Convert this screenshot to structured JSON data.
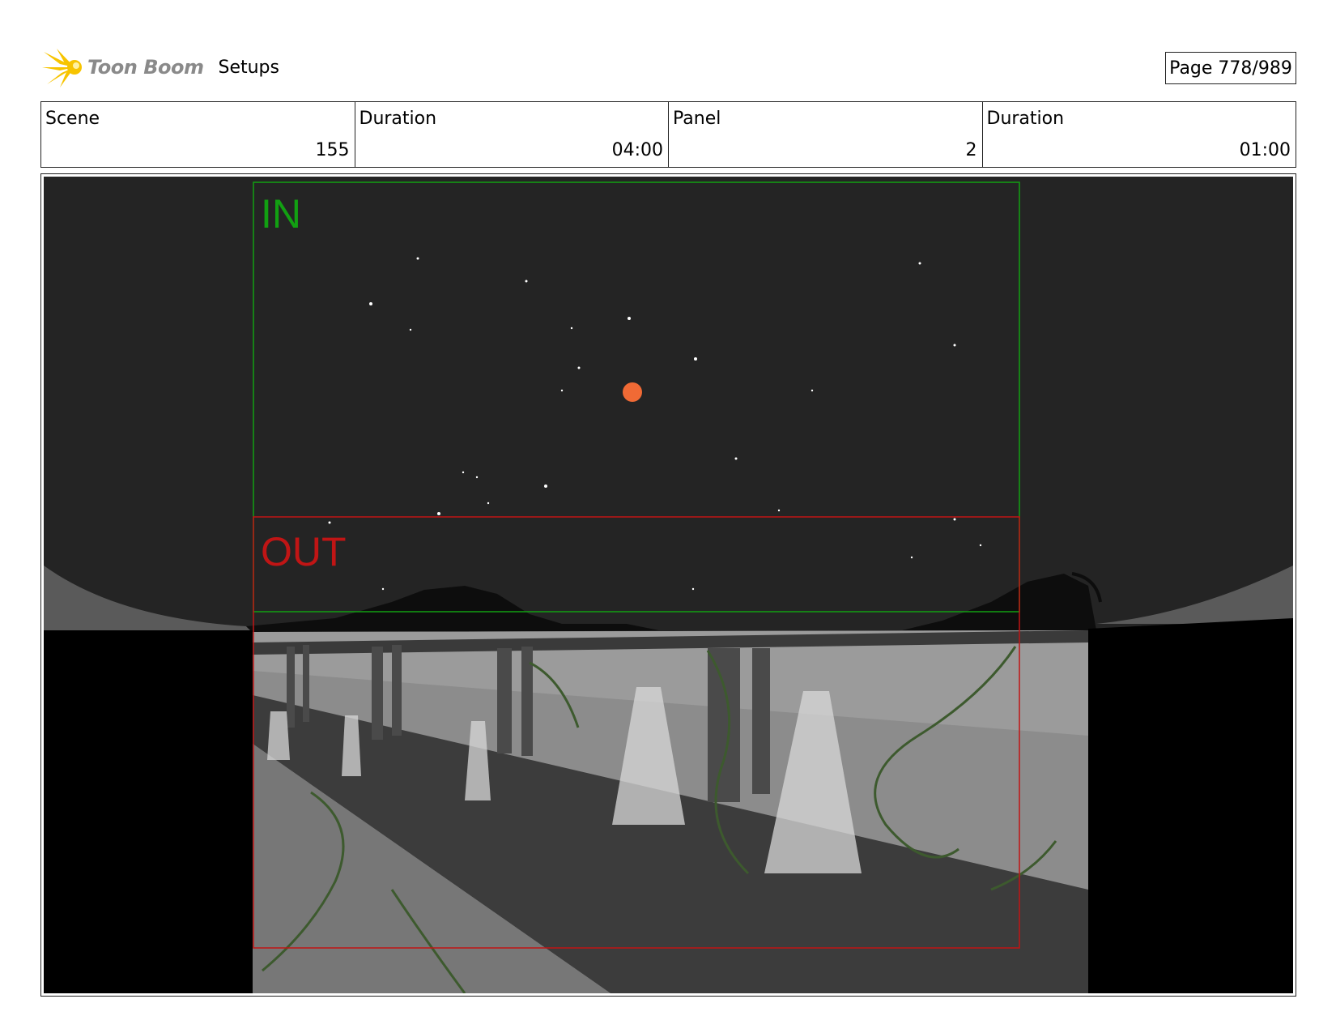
{
  "header": {
    "brand": "Toon Boom",
    "title": "Setups",
    "page": "Page 778/989",
    "logo_icon": "toon-boom-star-icon"
  },
  "info": {
    "scene_label": "Scene",
    "scene_value": "155",
    "scene_duration_label": "Duration",
    "scene_duration_value": "04:00",
    "panel_label": "Panel",
    "panel_value": "2",
    "panel_duration_label": "Duration",
    "panel_duration_value": "01:00"
  },
  "panel": {
    "in_label": "IN",
    "out_label": "OUT",
    "in_color": "#12a012",
    "out_color": "#c01515",
    "moon_color": "#f06a35",
    "sky_color": "#242424"
  }
}
